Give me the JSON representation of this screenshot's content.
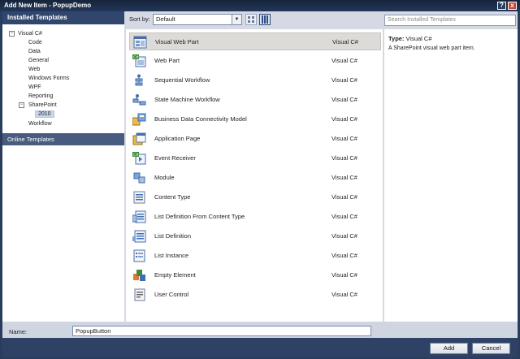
{
  "window": {
    "title": "Add New Item - PopupDemo",
    "help_label": "?",
    "close_label": "x"
  },
  "left_panel": {
    "header": "Installed Templates",
    "tree": [
      {
        "label": "Visual C#",
        "level": 0,
        "expander": "−"
      },
      {
        "label": "Code",
        "level": 1
      },
      {
        "label": "Data",
        "level": 1
      },
      {
        "label": "General",
        "level": 1
      },
      {
        "label": "Web",
        "level": 1
      },
      {
        "label": "Windows Forms",
        "level": 1
      },
      {
        "label": "WPF",
        "level": 1
      },
      {
        "label": "Reporting",
        "level": 1
      },
      {
        "label": "SharePoint",
        "level": 1,
        "expander": "−"
      },
      {
        "label": "2010",
        "level": 2,
        "selected": true
      },
      {
        "label": "Workflow",
        "level": 1
      }
    ],
    "online_templates": "Online Templates"
  },
  "toolbar": {
    "sort_label": "Sort by:",
    "sort_value": "Default"
  },
  "search": {
    "placeholder": "Search Installed Templates"
  },
  "templates": [
    {
      "name": "Visual Web Part",
      "lang": "Visual C#",
      "icon": "visual-web-part-icon",
      "selected": true
    },
    {
      "name": "Web Part",
      "lang": "Visual C#",
      "icon": "web-part-icon"
    },
    {
      "name": "Sequential Workflow",
      "lang": "Visual C#",
      "icon": "sequential-workflow-icon"
    },
    {
      "name": "State Machine Workflow",
      "lang": "Visual C#",
      "icon": "state-machine-workflow-icon"
    },
    {
      "name": "Business Data Connectivity Model",
      "lang": "Visual C#",
      "icon": "bdc-model-icon"
    },
    {
      "name": "Application Page",
      "lang": "Visual C#",
      "icon": "application-page-icon"
    },
    {
      "name": "Event Receiver",
      "lang": "Visual C#",
      "icon": "event-receiver-icon"
    },
    {
      "name": "Module",
      "lang": "Visual C#",
      "icon": "module-icon"
    },
    {
      "name": "Content Type",
      "lang": "Visual C#",
      "icon": "content-type-icon"
    },
    {
      "name": "List Definition From Content Type",
      "lang": "Visual C#",
      "icon": "list-definition-from-content-type-icon"
    },
    {
      "name": "List Definition",
      "lang": "Visual C#",
      "icon": "list-definition-icon"
    },
    {
      "name": "List Instance",
      "lang": "Visual C#",
      "icon": "list-instance-icon"
    },
    {
      "name": "Empty Element",
      "lang": "Visual C#",
      "icon": "empty-element-icon"
    },
    {
      "name": "User Control",
      "lang": "Visual C#",
      "icon": "user-control-icon"
    }
  ],
  "details": {
    "type_label": "Type:",
    "type_value": "Visual C#",
    "description": "A SharePoint visual web part item."
  },
  "bottom": {
    "name_label": "Name:",
    "name_value": "PopupButton",
    "add_label": "Add",
    "cancel_label": "Cancel"
  },
  "colors": {
    "chrome_dark": "#2b3d5d",
    "header_blue": "#30466c",
    "selection_gray": "#dcdbd8"
  }
}
